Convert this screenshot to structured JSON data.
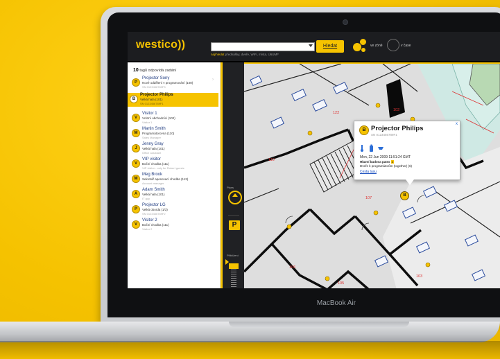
{
  "app": {
    "logo": "westico))",
    "search_hint_prefix": "naj/hledat",
    "search_hint": "přednášky, dveře, WiFi, místa, Ú6UMF",
    "search_button": "Hledat",
    "zone_label": "ve zóně",
    "history_label": "v čase",
    "colors": {
      "accent": "#f6c300",
      "dark": "#1c1d20",
      "link": "#1f3b80"
    }
  },
  "results": {
    "count": "10",
    "count_label": "tagů odpovídá zadání",
    "items": [
      {
        "badge": "P",
        "name": "Projector Sony",
        "loc": "Nové oddělení v programování (108)",
        "sub": "SN 0123456789F3"
      },
      {
        "badge": "B",
        "name": "Projector Philips",
        "loc": "Velká hala (101)",
        "sub": "SN 0123456789F1"
      },
      {
        "badge": "V",
        "name": "Visitor 1",
        "loc": "Vnitrní obchodníci (102)",
        "sub": "Visitor 1"
      },
      {
        "badge": "M",
        "name": "Martin Smith",
        "loc": "Programátorovna (110)",
        "sub": "Sales Manager"
      },
      {
        "badge": "J",
        "name": "Jenny Gray",
        "loc": "Velká hala (101)",
        "sub": "Office assistant"
      },
      {
        "badge": "V",
        "name": "VIP visitor",
        "loc": "Boční chodba (111)",
        "sub": "VIP visitor - only for Robert guests"
      },
      {
        "badge": "M",
        "name": "Meg Brook",
        "loc": "Sekretář apesovací chodba (113)",
        "sub": "Account manager"
      },
      {
        "badge": "A",
        "name": "Adam Smith",
        "loc": "Velká hala (101)",
        "sub": "IT guy"
      },
      {
        "badge": "P",
        "name": "Projector LG",
        "loc": "Velká oborda (1/3)",
        "sub": "SN 0123456789F2"
      },
      {
        "badge": "V",
        "name": "Visitor 2",
        "loc": "Boční chodba (111)",
        "sub": "Visitor 2"
      }
    ]
  },
  "toolbar": {
    "plans_label": "Plans",
    "parking": "P",
    "zoom_label": "Přiblížení"
  },
  "map": {
    "rooms": [
      "122",
      "102",
      "110",
      "107",
      "106",
      "105",
      "103"
    ],
    "popup": {
      "badge": "B",
      "title": "Projector Philips",
      "serial": "SN 0123456789F1",
      "date": "Mon, 22 Jun 2009 11:51:24 GMT",
      "building": "Hlavní budova patro",
      "floor": "1",
      "zone": "Dveře k programátorům (together) (6)",
      "link": "Cesta tasu",
      "close": "x"
    }
  },
  "device": {
    "label": "MacBook Air"
  }
}
